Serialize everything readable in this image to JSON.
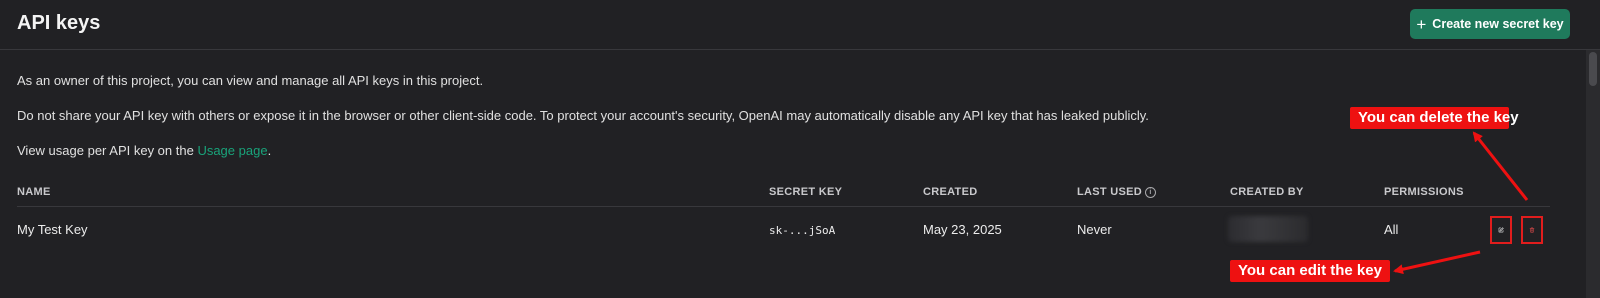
{
  "header": {
    "title": "API keys",
    "create_button_label": "Create new secret key",
    "create_button_icon": "plus-icon"
  },
  "description": {
    "line1": "As an owner of this project, you can view and manage all API keys in this project.",
    "line2": "Do not share your API key with others or expose it in the browser or other client-side code. To protect your account's security, OpenAI may automatically disable any API key that has leaked publicly.",
    "line3_prefix": "View usage per API key on the ",
    "line3_link": "Usage page",
    "line3_suffix": "."
  },
  "table": {
    "columns": [
      "NAME",
      "SECRET KEY",
      "CREATED",
      "LAST USED",
      "CREATED BY",
      "PERMISSIONS"
    ],
    "rows": [
      {
        "name": "My Test Key",
        "secret_key": "sk-...jSoA",
        "created": "May 23, 2025",
        "last_used": "Never",
        "permissions": "All"
      }
    ]
  },
  "annotations": {
    "delete_callout": "You can delete the key",
    "edit_callout": "You can edit the key"
  },
  "colors": {
    "background": "#212124",
    "accent_button": "#1f7a5c",
    "link": "#19a37a",
    "annotation": "#ee1111"
  }
}
